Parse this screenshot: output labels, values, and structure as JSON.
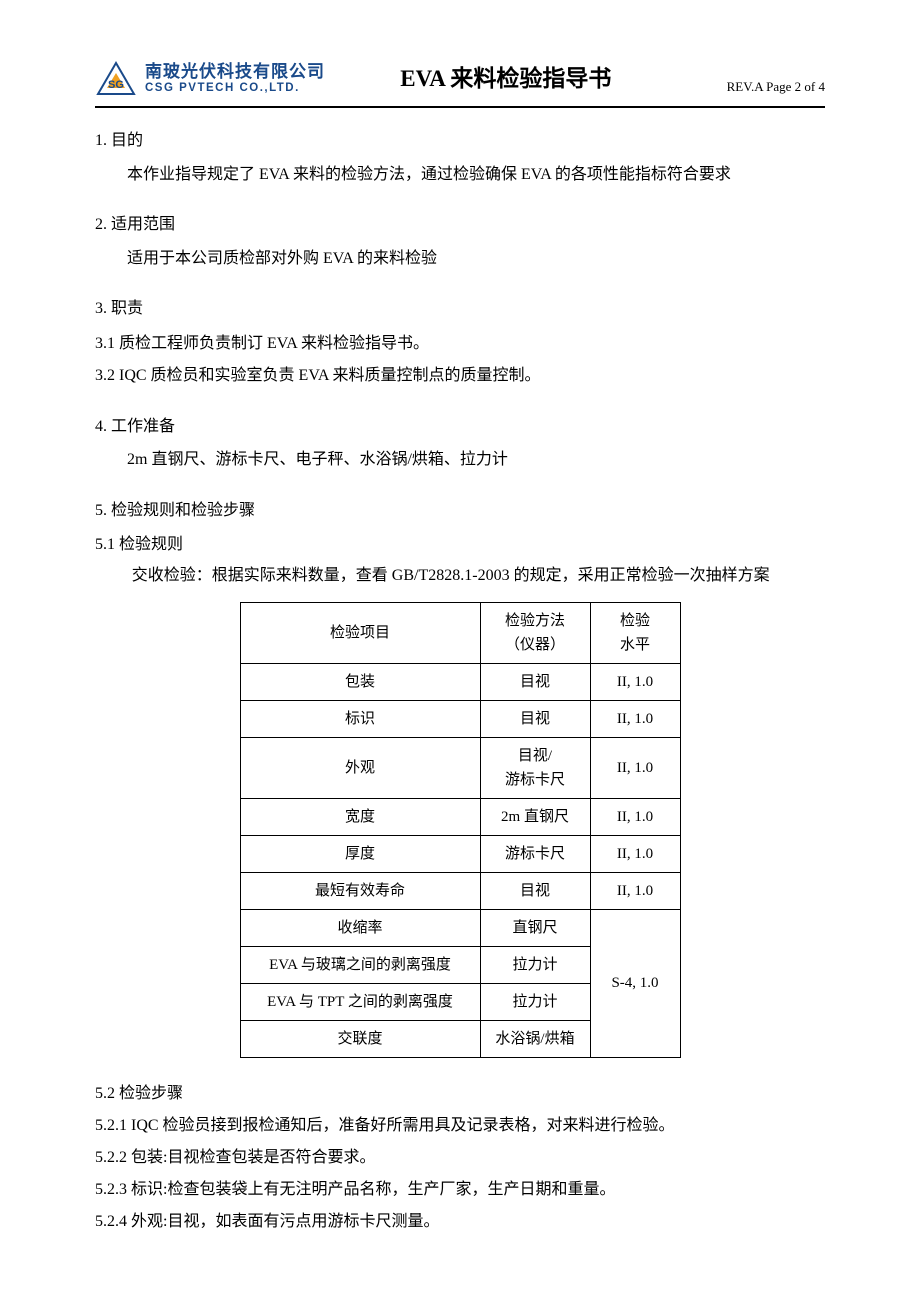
{
  "header": {
    "company_cn": "南玻光伏科技有限公司",
    "company_en": "CSG PVTECH CO.,LTD.",
    "doc_title": "EVA 来料检验指导书",
    "page_info": "REV.A  Page 2 of 4"
  },
  "s1": {
    "heading": "1. 目的",
    "body": "本作业指导规定了 EVA 来料的检验方法，通过检验确保 EVA 的各项性能指标符合要求"
  },
  "s2": {
    "heading": "2. 适用范围",
    "body": "适用于本公司质检部对外购 EVA 的来料检验"
  },
  "s3": {
    "heading": "3. 职责",
    "item1": "3.1 质检工程师负责制订 EVA 来料检验指导书。",
    "item2": "3.2  IQC 质检员和实验室负责 EVA 来料质量控制点的质量控制。"
  },
  "s4": {
    "heading": "4. 工作准备",
    "body": "2m 直钢尺、游标卡尺、电子秤、水浴锅/烘箱、拉力计"
  },
  "s5": {
    "heading": "5. 检验规则和检验步骤",
    "sub1": "5.1 检验规则",
    "note": "交收检验：根据实际来料数量，查看 GB/T2828.1-2003 的规定，采用正常检验一次抽样方案",
    "table": {
      "head": {
        "c1": "检验项目",
        "c2": "检验方法（仪器）",
        "c2a": "检验方法",
        "c2b": "（仪器）",
        "c3a": "检验",
        "c3b": "水平"
      },
      "rows": [
        {
          "item": "包装",
          "method": "目视",
          "level": "II, 1.0"
        },
        {
          "item": "标识",
          "method": "目视",
          "level": "II, 1.0"
        },
        {
          "item": "外观",
          "method": "目视/游标卡尺",
          "method_a": "目视/",
          "method_b": "游标卡尺",
          "level": "II, 1.0"
        },
        {
          "item": "宽度",
          "method": "2m 直钢尺",
          "level": "II, 1.0"
        },
        {
          "item": "厚度",
          "method": "游标卡尺",
          "level": "II, 1.0"
        },
        {
          "item": "最短有效寿命",
          "method": "目视",
          "level": "II, 1.0"
        },
        {
          "item": "收缩率",
          "method": "直钢尺"
        },
        {
          "item": "EVA 与玻璃之间的剥离强度",
          "method": "拉力计"
        },
        {
          "item": "EVA 与 TPT 之间的剥离强度",
          "method": "拉力计"
        },
        {
          "item": "交联度",
          "method": "水浴锅/烘箱"
        }
      ],
      "merged_level": "S-4, 1.0"
    },
    "sub2": "5.2 检验步骤",
    "steps": [
      "5.2.1 IQC 检验员接到报检通知后，准备好所需用具及记录表格，对来料进行检验。",
      "5.2.2 包装:目视检查包装是否符合要求。",
      "5.2.3 标识:检查包装袋上有无注明产品名称，生产厂家，生产日期和重量。",
      "5.2.4 外观:目视，如表面有污点用游标卡尺测量。"
    ]
  }
}
